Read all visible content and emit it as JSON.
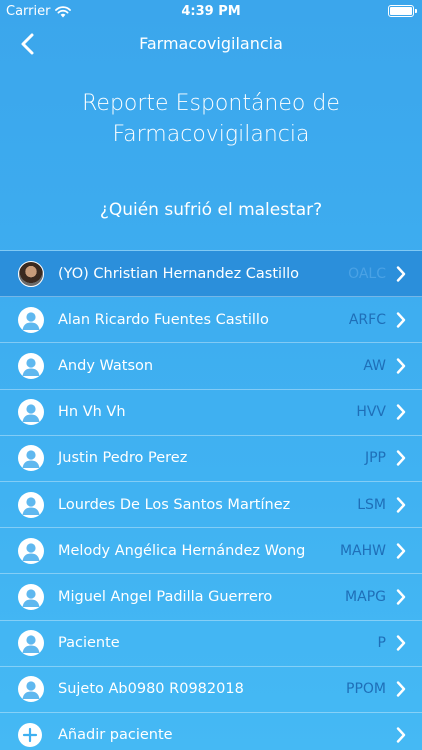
{
  "status": {
    "carrier": "Carrier",
    "time": "4:39 PM"
  },
  "nav": {
    "title": "Farmacovigilancia"
  },
  "page": {
    "heading_line1": "Reporte Espontáneo de",
    "heading_line2": "Farmacovigilancia",
    "question": "¿Quién sufrió el malestar?"
  },
  "people": [
    {
      "name": "(YO) Christian Hernandez Castillo",
      "code": "OALC",
      "selected": true,
      "avatar": "photo"
    },
    {
      "name": "Alan Ricardo Fuentes Castillo",
      "code": "ARFC"
    },
    {
      "name": "Andy Watson",
      "code": "AW"
    },
    {
      "name": "Hn Vh Vh",
      "code": "HVV"
    },
    {
      "name": "Justin Pedro Perez",
      "code": "JPP"
    },
    {
      "name": "Lourdes De Los Santos Martínez",
      "code": "LSM"
    },
    {
      "name": "Melody Angélica Hernández Wong",
      "code": "MAHW"
    },
    {
      "name": "Miguel Angel Padilla Guerrero",
      "code": "MAPG"
    },
    {
      "name": "Paciente",
      "code": "P"
    },
    {
      "name": "Sujeto Ab0980 R0982018",
      "code": "PPOM"
    }
  ],
  "add_patient": {
    "label": "Añadir paciente"
  },
  "icons": {
    "back": "chevron-left-icon",
    "row_arrow": "chevron-right-icon",
    "person": "person-icon",
    "add": "plus-circle-icon",
    "wifi": "wifi-icon",
    "battery": "battery-icon"
  },
  "colors": {
    "background": "#3fb0f1",
    "selected_row": "#2b8fdb",
    "code_text": "#1f6fb8"
  }
}
